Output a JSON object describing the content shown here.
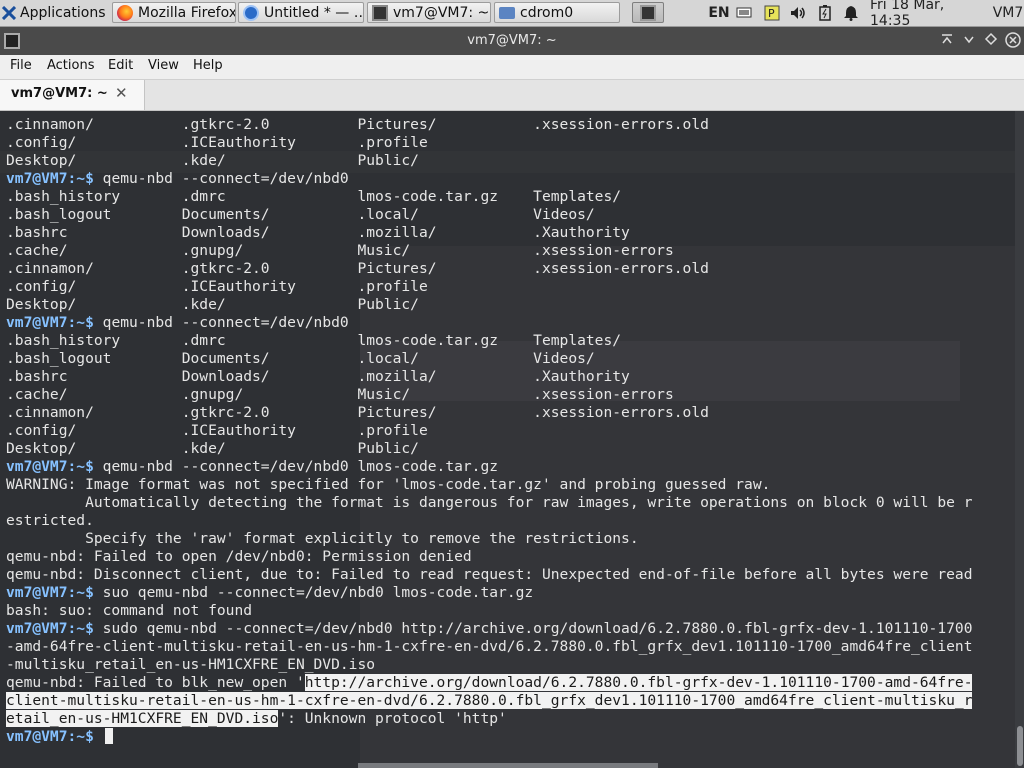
{
  "panel": {
    "apps_label": "Applications",
    "tasks": [
      {
        "label": "Mozilla Firefox",
        "icon": "firefox-icon"
      },
      {
        "label": "Untitled * — …",
        "icon": "text-editor-icon"
      },
      {
        "label": "vm7@VM7: ~",
        "icon": "terminal-icon"
      },
      {
        "label": "cdrom0",
        "icon": "folder-icon"
      }
    ],
    "lang": "EN",
    "clock": "Fri 18 Mar, 14:35",
    "user": "VM7"
  },
  "window": {
    "title": "vm7@VM7: ~",
    "menu": [
      "File",
      "Actions",
      "Edit",
      "View",
      "Help"
    ],
    "tab_label": "vm7@VM7: ~",
    "colors": {
      "prompt": "#86c1ff",
      "background": "#2e3034",
      "text": "#e6e6e6",
      "selection": "#f2f2f2"
    }
  },
  "terminal": {
    "prompt": "vm7@VM7:~$",
    "lines": [
      ".cinnamon/          .gtkrc-2.0          Pictures/           .xsession-errors.old",
      ".config/            .ICEauthority       .profile",
      "Desktop/            .kde/               Public/",
      {
        "prompt": "vm7@VM7:~$",
        "cmd": " qemu-nbd --connect=/dev/nbd0"
      },
      ".bash_history       .dmrc               lmos-code.tar.gz    Templates/",
      ".bash_logout        Documents/          .local/             Videos/",
      ".bashrc             Downloads/          .mozilla/           .Xauthority",
      ".cache/             .gnupg/             Music/              .xsession-errors",
      ".cinnamon/          .gtkrc-2.0          Pictures/           .xsession-errors.old",
      ".config/            .ICEauthority       .profile",
      "Desktop/            .kde/               Public/",
      {
        "prompt": "vm7@VM7:~$",
        "cmd": " qemu-nbd --connect=/dev/nbd0"
      },
      ".bash_history       .dmrc               lmos-code.tar.gz    Templates/",
      ".bash_logout        Documents/          .local/             Videos/",
      ".bashrc             Downloads/          .mozilla/           .Xauthority",
      ".cache/             .gnupg/             Music/              .xsession-errors",
      ".cinnamon/          .gtkrc-2.0          Pictures/           .xsession-errors.old",
      ".config/            .ICEauthority       .profile",
      "Desktop/            .kde/               Public/",
      {
        "prompt": "vm7@VM7:~$",
        "cmd": " qemu-nbd --connect=/dev/nbd0 lmos-code.tar.gz"
      },
      "WARNING: Image format was not specified for 'lmos-code.tar.gz' and probing guessed raw.",
      "         Automatically detecting the format is dangerous for raw images, write operations on block 0 will be r",
      "estricted.",
      "         Specify the 'raw' format explicitly to remove the restrictions.",
      "qemu-nbd: Failed to open /dev/nbd0: Permission denied",
      "qemu-nbd: Disconnect client, due to: Failed to read request: Unexpected end-of-file before all bytes were read",
      {
        "prompt": "vm7@VM7:~$",
        "cmd": " suo qemu-nbd --connect=/dev/nbd0 lmos-code.tar.gz"
      },
      "bash: suo: command not found",
      {
        "prompt": "vm7@VM7:~$",
        "cmd": " sudo qemu-nbd --connect=/dev/nbd0 http://archive.org/download/6.2.7880.0.fbl-grfx-dev-1.101110-1700"
      },
      "-amd-64fre-client-multisku-retail-en-us-hm-1-cxfre-en-dvd/6.2.7880.0.fbl_grfx_dev1.101110-1700_amd64fre_client",
      "-multisku_retail_en-us-HM1CXFRE_EN_DVD.iso",
      {
        "pre": "qemu-nbd: Failed to blk_new_open '",
        "sel": "http://archive.org/download/6.2.7880.0.fbl-grfx-dev-1.101110-1700-amd-64fre-"
      },
      {
        "sel": "client-multisku-retail-en-us-hm-1-cxfre-en-dvd/6.2.7880.0.fbl_grfx_dev1.101110-1700_amd64fre_client-multisku_r"
      },
      {
        "sel": "etail_en-us-HM1CXFRE_EN_DVD.iso",
        "post": "': Unknown protocol 'http'"
      },
      {
        "prompt": "vm7@VM7:~$",
        "cmd": " ",
        "cursor": true
      }
    ]
  }
}
